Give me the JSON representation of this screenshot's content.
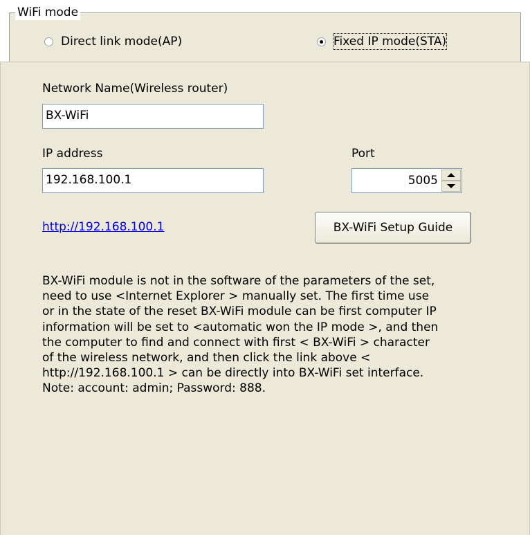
{
  "wifi_mode": {
    "legend": "WiFi mode",
    "options": [
      {
        "label": "Direct link mode(AP)",
        "checked": false
      },
      {
        "label": "Fixed IP mode(STA)",
        "checked": true
      }
    ]
  },
  "network": {
    "label": "Network Name(Wireless router)",
    "value": "BX-WiFi"
  },
  "ip": {
    "label": "IP address",
    "value": "192.168.100.1"
  },
  "port": {
    "label": "Port",
    "value": "5005"
  },
  "link": {
    "text": "http://192.168.100.1"
  },
  "setup_button": {
    "label": "BX-WiFi Setup Guide"
  },
  "description": "BX-WiFi module is not in the software of the parameters of the set,\nneed to use <Internet Explorer > manually set. The first time use\nor in the state of the reset BX-WiFi module can be first computer IP\ninformation will be set to <automatic won the IP mode >, and then\nthe computer to find and connect with first < BX-WiFi > character\nof the wireless network, and then click the link above <\nhttp://192.168.100.1 > can be directly into BX-WiFi set interface.\nNote: account: admin; Password: 888.",
  "colors": {
    "panel_bg": "#ece9d8",
    "link": "#0000ee",
    "textbox_border": "#7f9db9"
  }
}
